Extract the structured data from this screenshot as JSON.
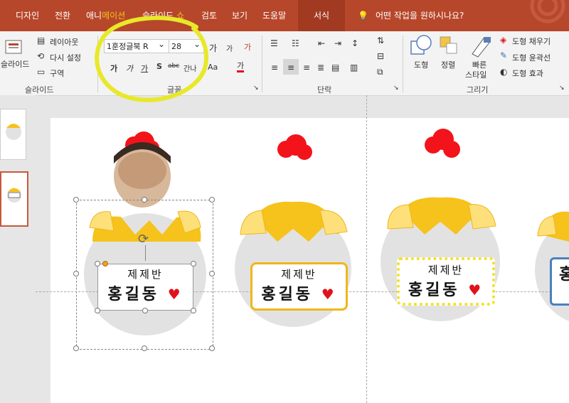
{
  "tabs": {
    "design": "디자인",
    "transitions": "전환",
    "animations_a": "애니",
    "animations_b": "메이션",
    "slideshow_a": "슬라이드",
    "slideshow_b": "쇼",
    "review": "검토",
    "view": "보기",
    "help": "도움말",
    "format": "서식",
    "tell_me": "어떤 작업을 원하시나요?"
  },
  "slides_group": {
    "new_slide": "슬라이드",
    "layout": "레이아웃",
    "reset": "다시 설정",
    "section": "구역",
    "label": "슬라이드"
  },
  "font_group": {
    "font_name": "1훈정글북 R",
    "font_size": "28",
    "grow": "가",
    "shrink": "가",
    "clear_format": "가",
    "bold": "가",
    "italic": "가",
    "underline": "가",
    "shadow": "S",
    "strike": "abc",
    "spacing": "간나",
    "change_case": "Aa",
    "font_color": "가",
    "label": "글꼴"
  },
  "paragraph_group": {
    "label": "단락"
  },
  "drawing_group": {
    "shapes": "도형",
    "arrange": "정렬",
    "quick_styles_a": "빠른",
    "quick_styles_b": "스타일",
    "shape_fill": "도형 채우기",
    "shape_outline": "도형 윤곽선",
    "shape_effects": "도형 효과",
    "label": "그리기"
  },
  "cards": [
    {
      "class_name": "제제반",
      "student": "홍길동",
      "heart": "♥"
    },
    {
      "class_name": "제제반",
      "student": "홍길동",
      "heart": "♥"
    },
    {
      "class_name": "제제반",
      "student": "홍길동",
      "heart": "♥"
    },
    {
      "class_name": "",
      "student": "홍",
      "heart": ""
    }
  ],
  "colors": {
    "accent_tab": "#b7472a",
    "highlight_yellow": "#e8e82a",
    "egg_gray": "#e2e2e2",
    "chick_yellow": "#f6c21c",
    "comb_red": "#f2141a"
  }
}
